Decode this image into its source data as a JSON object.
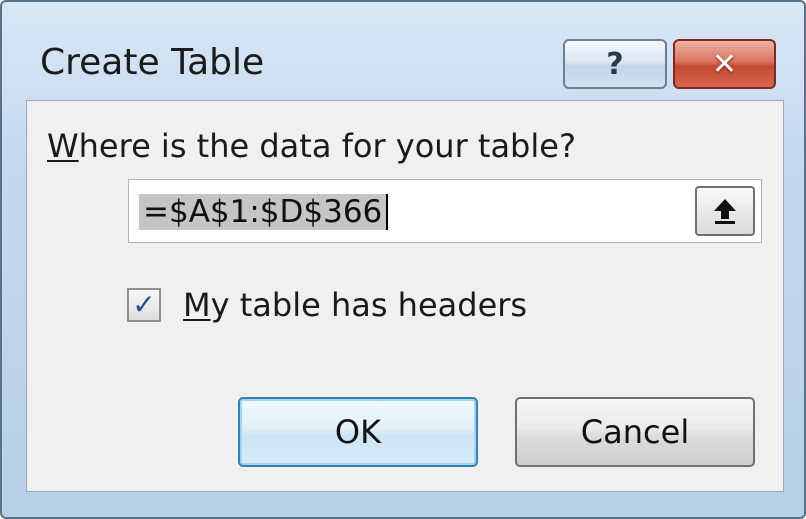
{
  "dialog": {
    "title": "Create Table",
    "help_glyph": "?",
    "close_glyph": "✕"
  },
  "prompt": {
    "prefix": "W",
    "rest": "here is the data for your table?"
  },
  "range_input": {
    "value": "=$A$1:$D$366",
    "collapse_icon": "upload-arrow-icon"
  },
  "headers_checkbox": {
    "checked": true,
    "check_glyph": "✓",
    "label_prefix": "M",
    "label_rest": "y table has headers"
  },
  "buttons": {
    "ok_label": "OK",
    "cancel_label": "Cancel"
  },
  "colors": {
    "title_bar": "#c6d9ee",
    "close_button": "#c24a33",
    "default_button_border": "#3c7fb1"
  }
}
